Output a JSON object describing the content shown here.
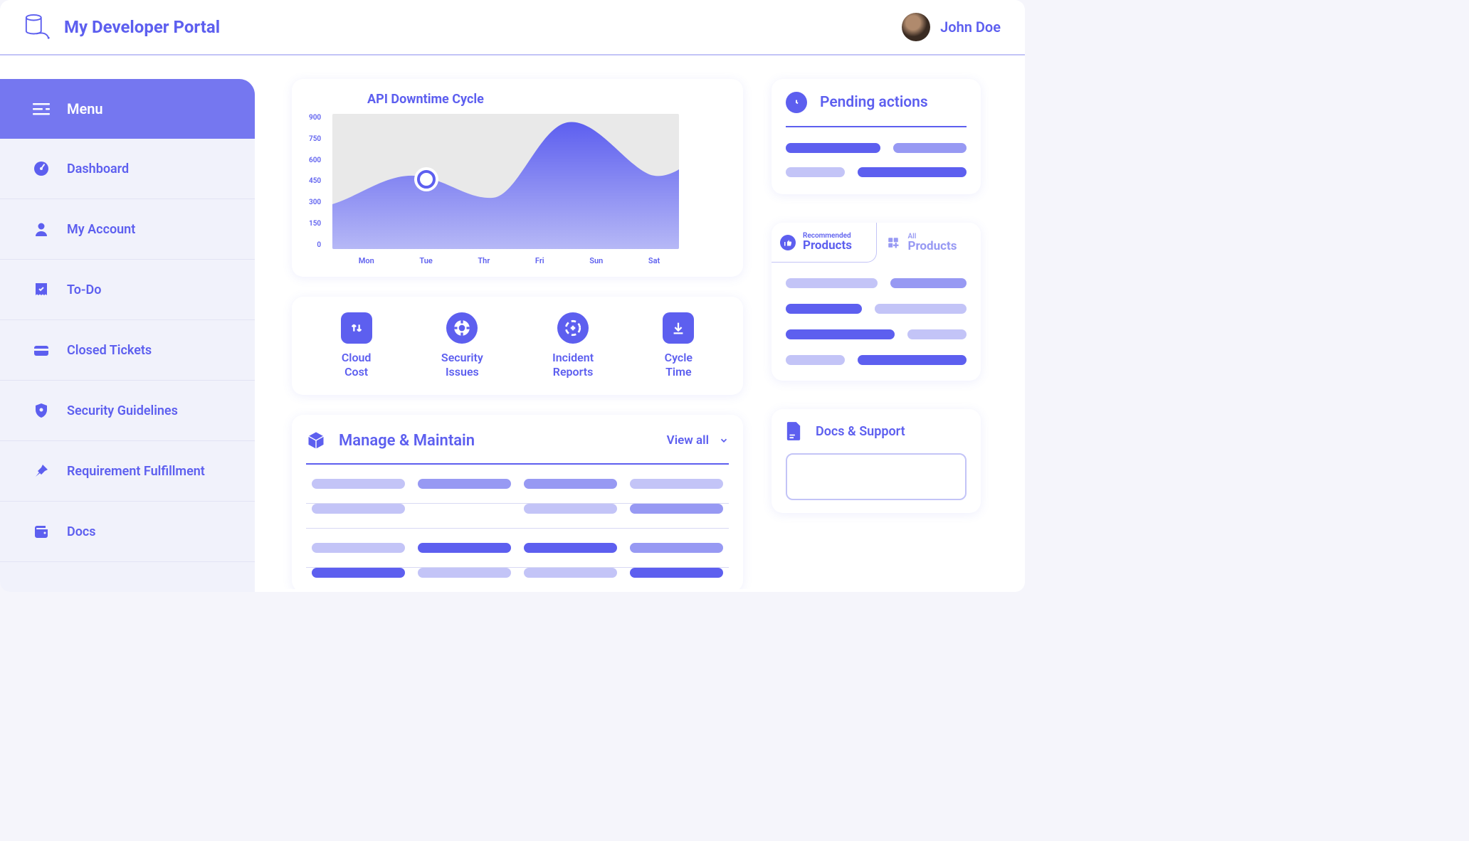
{
  "header": {
    "app_title": "My Developer Portal",
    "user_name": "John Doe"
  },
  "sidebar": {
    "menu_label": "Menu",
    "items": [
      {
        "label": "Dashboard",
        "icon": "gauge-icon"
      },
      {
        "label": "My Account",
        "icon": "user-icon"
      },
      {
        "label": "To-Do",
        "icon": "receipt-icon"
      },
      {
        "label": "Closed Tickets",
        "icon": "card-icon"
      },
      {
        "label": "Security Guidelines",
        "icon": "shield-icon"
      },
      {
        "label": "Requirement Fulfillment",
        "icon": "pin-icon"
      },
      {
        "label": "Docs",
        "icon": "wallet-icon"
      }
    ]
  },
  "chart_data": {
    "type": "area",
    "title": "API Downtime Cycle",
    "xlabel": "",
    "ylabel": "",
    "ylim": [
      0,
      900
    ],
    "yticks": [
      900,
      750,
      600,
      450,
      300,
      150,
      0
    ],
    "categories": [
      "Mon",
      "Tue",
      "Thr",
      "Fri",
      "Sun",
      "Sat"
    ],
    "values": [
      300,
      560,
      420,
      890,
      470,
      550
    ],
    "highlight_index": 1
  },
  "quick": {
    "items": [
      {
        "line1": "Cloud",
        "line2": "Cost",
        "icon": "updown-icon"
      },
      {
        "line1": "Security",
        "line2": "Issues",
        "icon": "lifering-icon"
      },
      {
        "line1": "Incident",
        "line2": "Reports",
        "icon": "crosshair-icon"
      },
      {
        "line1": "Cycle",
        "line2": "Time",
        "icon": "download-icon"
      }
    ]
  },
  "manage": {
    "title": "Manage & Maintain",
    "view_all": "View all"
  },
  "pending": {
    "title": "Pending actions"
  },
  "products": {
    "tab1_small": "Recommended",
    "tab1_big": "Products",
    "tab2_small": "All",
    "tab2_big": "Products"
  },
  "docs": {
    "title": "Docs & Support"
  }
}
